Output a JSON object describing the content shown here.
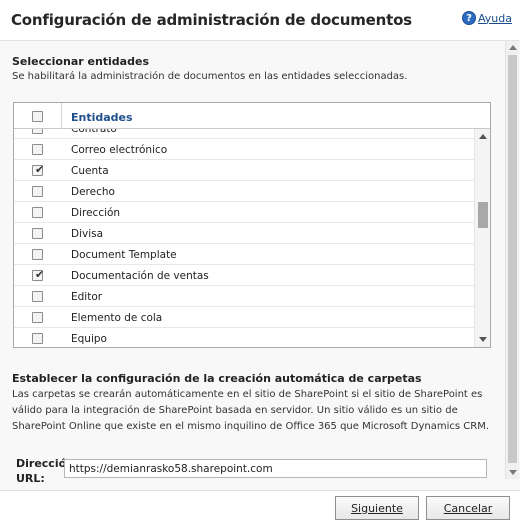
{
  "header": {
    "title": "Configuración de administración de documentos",
    "help_label": "Ayuda"
  },
  "entities_section": {
    "title": "Seleccionar entidades",
    "description": "Se habilitará la administración de documentos en las entidades seleccionadas.",
    "column_header": "Entidades",
    "rows": [
      {
        "label": "Contrato",
        "checked": false
      },
      {
        "label": "Correo electrónico",
        "checked": false
      },
      {
        "label": "Cuenta",
        "checked": true
      },
      {
        "label": "Derecho",
        "checked": false
      },
      {
        "label": "Dirección",
        "checked": false
      },
      {
        "label": "Divisa",
        "checked": false
      },
      {
        "label": "Document Template",
        "checked": false
      },
      {
        "label": "Documentación de ventas",
        "checked": true
      },
      {
        "label": "Editor",
        "checked": false
      },
      {
        "label": "Elemento de cola",
        "checked": false
      },
      {
        "label": "Equipo",
        "checked": false
      }
    ]
  },
  "folder_section": {
    "title": "Establecer la configuración de la creación automática de carpetas",
    "description_lines": [
      "Las carpetas se crearán automáticamente en el sitio de SharePoint si el sitio de SharePoint es",
      "válido para la integración de SharePoint basada en servidor. Un sitio válido es un sitio de",
      "SharePoint Online que existe en el mismo inquilino de Office 365 que Microsoft Dynamics CRM."
    ],
    "url_label_line1": "Dirección",
    "url_label_line2": "URL:",
    "url_value": "https://demianrasko58.sharepoint.com"
  },
  "footer": {
    "next_label": "Siguiente",
    "cancel_label": "Cancelar"
  }
}
